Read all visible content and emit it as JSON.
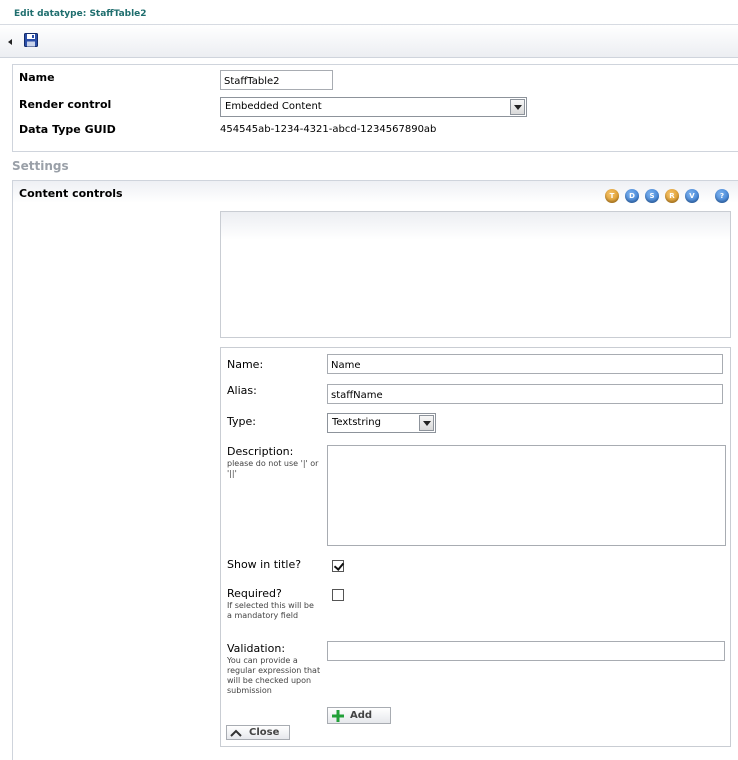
{
  "title": "Edit datatype: StaffTable2",
  "properties": {
    "name_label": "Name",
    "name_value": "StaffTable2",
    "render_label": "Render control",
    "render_value": "Embedded Content",
    "guid_label": "Data Type GUID",
    "guid_value": "454545ab-1234-4321-abcd-1234567890ab"
  },
  "settings_header": "Settings",
  "content_controls": {
    "label": "Content controls",
    "icons": [
      {
        "letter": "T",
        "color": "#d08a18"
      },
      {
        "letter": "D",
        "color": "#2a6fc9"
      },
      {
        "letter": "S",
        "color": "#2a6fc9"
      },
      {
        "letter": "R",
        "color": "#d08a18"
      },
      {
        "letter": "V",
        "color": "#2a6fc9"
      },
      {
        "letter": "?",
        "color": "#2a6fc9"
      }
    ]
  },
  "field_editor": {
    "name_label": "Name:",
    "name_value": "Name",
    "alias_label": "Alias:",
    "alias_value": "staffName",
    "type_label": "Type:",
    "type_value": "Textstring",
    "description_label": "Description:",
    "description_hint": "please do not use '|' or '||'",
    "show_in_title_label": "Show in title?",
    "show_in_title_checked": true,
    "required_label": "Required?",
    "required_hint": "If selected this will be a mandatory field",
    "required_checked": false,
    "validation_label": "Validation:",
    "validation_hint": "You can provide a regular expression that will be checked upon submission",
    "validation_value": "",
    "add_label": "Add",
    "close_label": "Close"
  }
}
